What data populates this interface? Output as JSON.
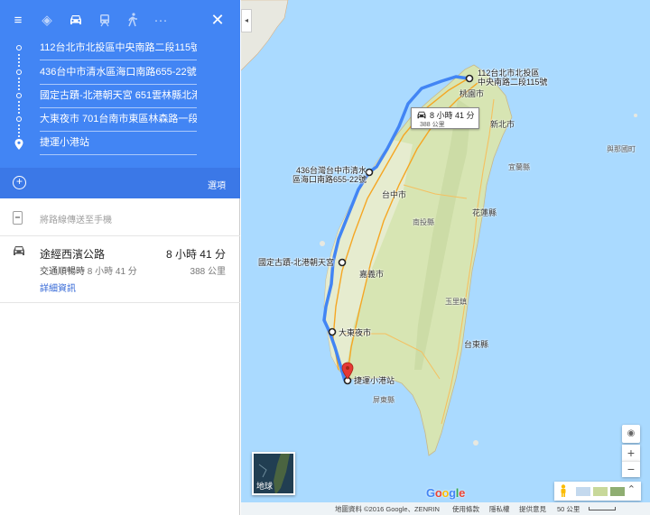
{
  "modes": {
    "menu_icon": "menu-icon",
    "best_icon": "directions-icon",
    "driving_icon": "car-icon",
    "transit_icon": "train-icon",
    "walking_icon": "walk-icon",
    "more_icon": "more-icon",
    "close_icon": "close-icon",
    "menu_glyph": "≡",
    "best_glyph": "◈",
    "car_glyph": "🚘",
    "transit_glyph": "🚆",
    "walk_glyph": "🚶",
    "more_glyph": "···",
    "close_glyph": "✕"
  },
  "waypoints": [
    "112台北市北投區中央南路二段115號",
    "436台中市清水區海口南路655-22號",
    "國定古蹟-北港朝天宮 651雲林縣北港鎮",
    "大東夜市 701台南市東區林森路一段316",
    "捷運小港站"
  ],
  "options": {
    "add_glyph": "+",
    "label": "選項"
  },
  "send": {
    "label": "將路線傳送至手機"
  },
  "route": {
    "name": "途經西濱公路",
    "time": "8 小時 41 分",
    "traffic_label": "交通順暢時",
    "traffic_time": "8 小時 41 分",
    "distance": "388 公里",
    "details": "詳細資訊"
  },
  "map": {
    "collapse_glyph": "◂",
    "popup_time": "8 小時 41 分",
    "popup_distance": "388 公里",
    "markers": {
      "start": "112台北市北投區\n中央南路二段115號",
      "taichung": "436台灣台中市清水\n區海口南路655-22號",
      "beigang": "國定古蹟-北港朝天宮",
      "dadong": "大東夜市",
      "end": "捷運小港站"
    },
    "cities": {
      "taoyuan": "桃園市",
      "taichung": "台中市",
      "hualien": "花蓮縣",
      "chiayi": "嘉義市",
      "taitung": "台東縣",
      "yilan": "宜蘭縣",
      "yuli": "玉里鎮",
      "nantou": "南投縣",
      "miaoli": "苗栗縣",
      "hsinchu": "新竹縣",
      "pingtung": "屏東縣",
      "yonaguni": "與那國町",
      "taipei": "台北市"
    },
    "satellite_label": "地球",
    "zoom_in": "+",
    "zoom_out": "−",
    "locate_glyph": "◉",
    "expand_glyph": "⌃",
    "google": [
      "G",
      "o",
      "o",
      "g",
      "l",
      "e"
    ],
    "google_colors": [
      "#4285f4",
      "#ea4335",
      "#fbbc05",
      "#4285f4",
      "#34a853",
      "#ea4335"
    ]
  },
  "footer": {
    "attribution": "地圖資料 ©2016 Google、ZENRIN",
    "terms": "使用條款",
    "privacy": "隱私權",
    "feedback": "提供意見",
    "scale": "50 公里"
  },
  "colors": {
    "header_blue": "#4285f4",
    "options_blue": "#3b78e7",
    "route_blue": "#4285f4",
    "sea": "#aadaff",
    "land": "#d7e5b3"
  }
}
